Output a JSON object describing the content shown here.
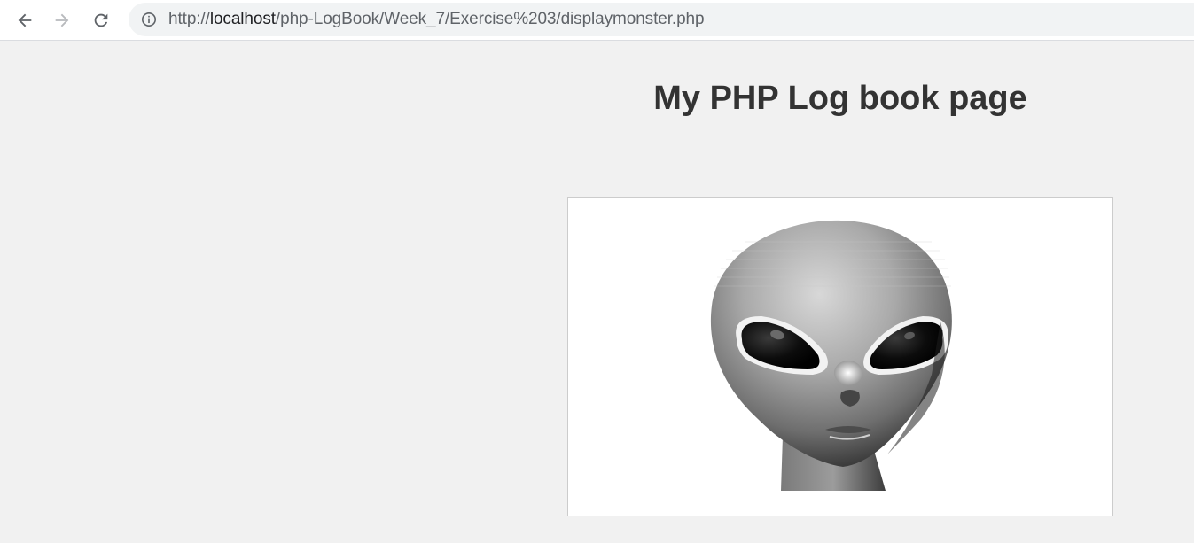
{
  "browser": {
    "url_scheme": "http://",
    "url_host": "localhost",
    "url_path": "/php-LogBook/Week_7/Exercise%203/displaymonster.php",
    "icons": {
      "back": "arrow-left-icon",
      "forward": "arrow-right-icon",
      "reload": "reload-icon",
      "info": "info-icon"
    }
  },
  "page": {
    "title": "My PHP Log book page",
    "image_subject": "alien-head"
  },
  "colors": {
    "page_background": "#f1f1f1",
    "title_text": "#333333",
    "omnibox_background": "#f1f3f4"
  }
}
